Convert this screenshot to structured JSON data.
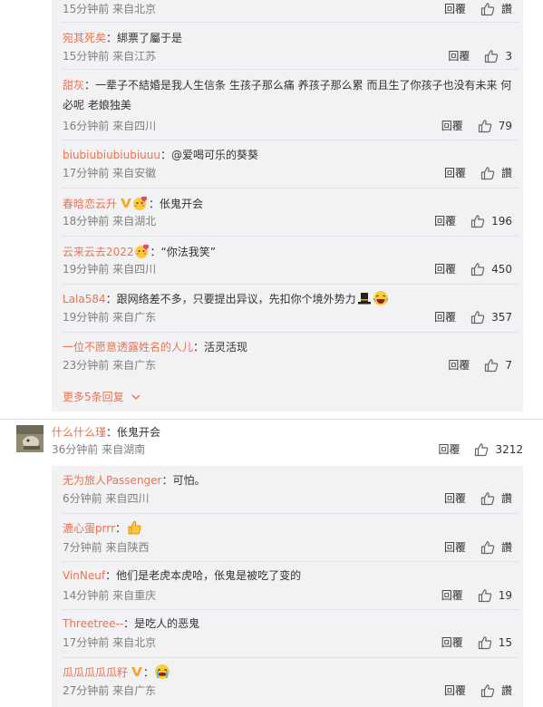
{
  "reply_label": "回覆",
  "thread1": {
    "replies": [
      {
        "nick": "",
        "text": "",
        "time": "15分钟前",
        "location": "来自北京",
        "likes": "讚"
      },
      {
        "nick": "宛其死矣",
        "text": "：綁票了屬于是",
        "time": "15分钟前",
        "location": "来自江苏",
        "likes": "3"
      },
      {
        "nick": "甜灰",
        "text": "：一辈子不結婚是我人生信条 生孩子那么痛 养孩子那么累 而且生了你孩子也没有未来 何必呢 老娘独美",
        "time": "16分钟前",
        "location": "来自四川",
        "likes": "79"
      },
      {
        "nick": "biubiubiubiubiuuu",
        "text": "：@爱喝可乐的葵葵",
        "time": "17分钟前",
        "location": "来自安徽",
        "likes": "讚"
      },
      {
        "nick": "春晗恋云升",
        "text": "：伥鬼开会",
        "time": "18分钟前",
        "location": "来自湖北",
        "likes": "196"
      },
      {
        "nick": "云来云去2022",
        "text": "：“你法我笑”",
        "time": "19分钟前",
        "location": "来自四川",
        "likes": "450"
      },
      {
        "nick": "Lala584",
        "text": "：跟网络差不多，只要提出异议，先扣你个境外势力",
        "time": "19分钟前",
        "location": "来自广东",
        "likes": "357"
      },
      {
        "nick": "一位不愿意透露姓名的人儿",
        "text": "：活灵活现",
        "time": "23分钟前",
        "location": "来自广东",
        "likes": "7"
      }
    ],
    "more_label": "更多5条回复"
  },
  "main_comment": {
    "nick": "什么什么瑾",
    "text": "：伥鬼开会",
    "time": "36分钟前",
    "location": "来自湖南",
    "likes": "3212"
  },
  "thread2": {
    "replies": [
      {
        "nick": "无为旅人Passenger",
        "text": "：可怕。",
        "time": "6分钟前",
        "location": "来自四川",
        "likes": "讚"
      },
      {
        "nick": "漉心蛋prrr",
        "text": "：",
        "time": "7分钟前",
        "location": "来自陕西",
        "likes": "讚"
      },
      {
        "nick": "VinNeuf",
        "text": "：他们是老虎本虎哈，伥鬼是被吃了变的",
        "time": "14分钟前",
        "location": "来自重庆",
        "likes": "19"
      },
      {
        "nick": "Threetree--",
        "text": "：是吃人的恶鬼",
        "time": "17分钟前",
        "location": "来自北京",
        "likes": "15"
      },
      {
        "nick": "瓜瓜瓜瓜瓜籽",
        "text": "：",
        "time": "27分钟前",
        "location": "来自广东",
        "likes": "讚"
      }
    ]
  },
  "colors": {
    "nickname": "#eb7350",
    "panel_bg": "#f2f2f5",
    "meta": "#808080"
  },
  "icons": {
    "like": "thumbs-up-icon",
    "more": "chevron-down-icon",
    "vip": "vip-badge-icon"
  }
}
